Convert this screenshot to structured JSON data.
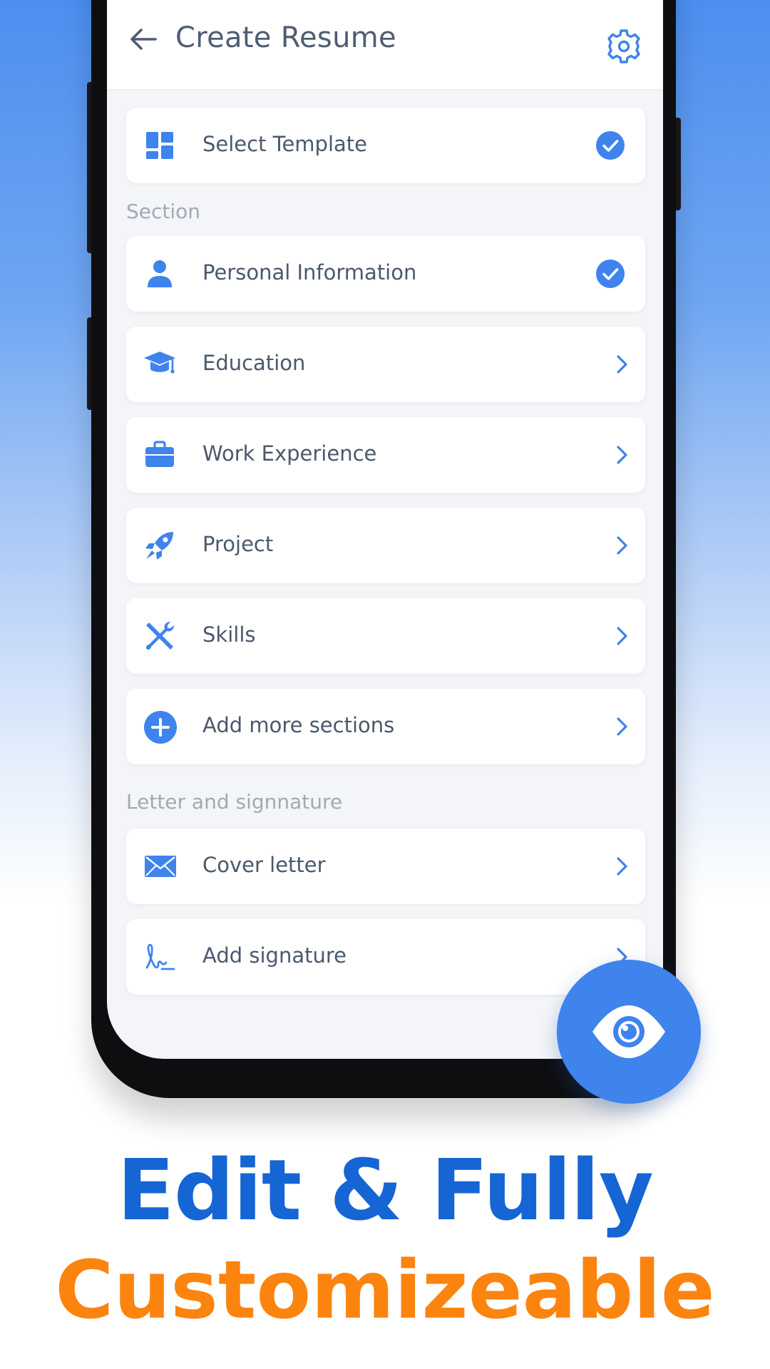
{
  "header": {
    "title": "Create Resume",
    "back_icon": "arrow-left-icon",
    "settings_icon": "gear-icon"
  },
  "template": {
    "label": "Select Template",
    "icon": "grid-template-icon",
    "status": "completed"
  },
  "section_heading": "Section",
  "sections": [
    {
      "label": "Personal Information",
      "icon": "person-icon",
      "status": "completed"
    },
    {
      "label": "Education",
      "icon": "graduation-cap-icon",
      "status": "chevron"
    },
    {
      "label": "Work Experience",
      "icon": "briefcase-icon",
      "status": "chevron"
    },
    {
      "label": "Project",
      "icon": "rocket-icon",
      "status": "chevron"
    },
    {
      "label": "Skills",
      "icon": "tools-icon",
      "status": "chevron"
    },
    {
      "label": "Add more sections",
      "icon": "plus-circle-icon",
      "status": "chevron"
    }
  ],
  "letter_heading": "Letter and signnature",
  "letter_items": [
    {
      "label": "Cover letter",
      "icon": "envelope-icon",
      "status": "chevron"
    },
    {
      "label": "Add signature",
      "icon": "signature-icon",
      "status": "chevron"
    }
  ],
  "fab": {
    "icon": "eye-icon"
  },
  "promo": {
    "line1": "Edit & Fully",
    "line2": "Customizeable"
  },
  "colors": {
    "accent": "#3f83ec",
    "headline_blue": "#1565d4",
    "headline_orange": "#fb840f",
    "text": "#4b586d",
    "muted": "#a2a9b4"
  }
}
